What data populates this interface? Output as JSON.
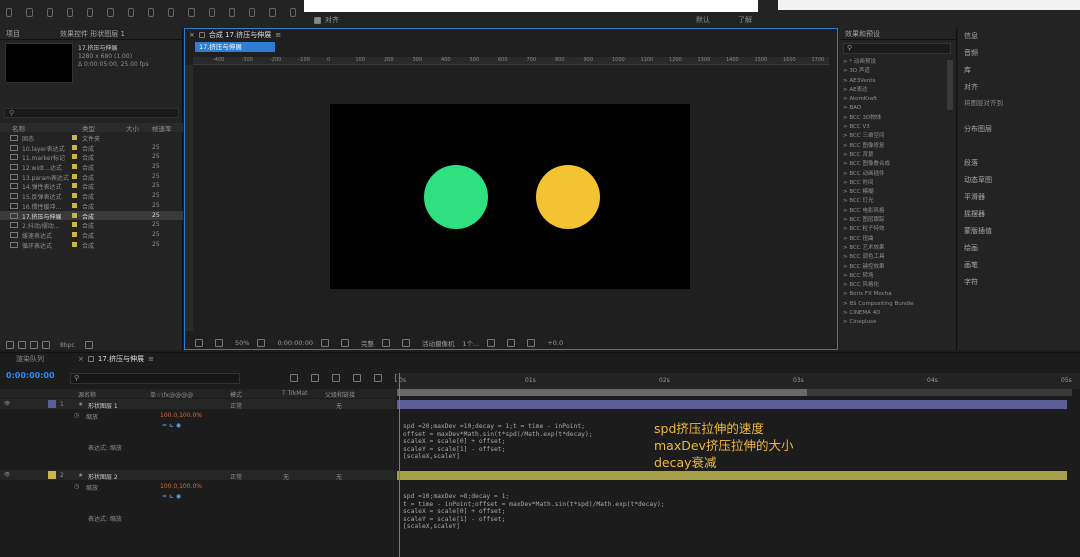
{
  "toolbar": {
    "snap_label": "对齐",
    "workspace_default": "默认",
    "workspace_learn": "了解"
  },
  "project": {
    "tab_label": "项目",
    "effect_controls_label": "效果控件 形状图层 1",
    "comp_name": "17.挤压与伸展",
    "comp_size": "1280 x 680 (1.00)",
    "comp_duration": "Δ 0:00:05:00, 25.00 fps",
    "columns": {
      "name": "名称",
      "type": "类型",
      "size": "大小",
      "rate": "帧速率"
    },
    "items": [
      {
        "name": "固态",
        "type": "文件夹",
        "rate": ""
      },
      {
        "name": "10.layer表达式",
        "type": "合成",
        "rate": "25"
      },
      {
        "name": "11.marker标记",
        "type": "合成",
        "rate": "25"
      },
      {
        "name": "12.widt...达式",
        "type": "合成",
        "rate": "25"
      },
      {
        "name": "13.param表达式",
        "type": "合成",
        "rate": "25"
      },
      {
        "name": "14.弹性表达式",
        "type": "合成",
        "rate": "25"
      },
      {
        "name": "15.反弹表达式",
        "type": "合成",
        "rate": "25"
      },
      {
        "name": "16.惯性缓冲...",
        "type": "合成",
        "rate": "25"
      },
      {
        "name": "17.挤压与伸展",
        "type": "合成",
        "rate": "25"
      },
      {
        "name": "2.抖动/摆动...",
        "type": "合成",
        "rate": "25"
      },
      {
        "name": "缓速表达式",
        "type": "合成",
        "rate": "25"
      },
      {
        "name": "循环表达式",
        "type": "合成",
        "rate": "25"
      }
    ],
    "bpc": "8bpc"
  },
  "comp": {
    "tab_label": "合成 17.挤压与伸展",
    "breadcrumb": "17.挤压与伸展",
    "ruler_ticks": [
      "-400",
      "-300",
      "-200",
      "-100",
      "0",
      "100",
      "200",
      "300",
      "400",
      "500",
      "600",
      "700",
      "800",
      "900",
      "1000",
      "1100",
      "1200",
      "1300",
      "1400",
      "1500",
      "1600",
      "1700"
    ],
    "footer": {
      "zoom": "50%",
      "timecode": "0:00:00:00",
      "quality": "完整",
      "camera": "活动摄像机",
      "views": "1个...",
      "exposure": "+0.0"
    },
    "colors": {
      "green": "#2ee07f",
      "yellow": "#f3c332"
    }
  },
  "effects": {
    "title": "效果和预设",
    "items": [
      "* 动画预设",
      "3D 声道",
      "AE3Vents",
      "AE表达",
      "AtomKraft",
      "BAO",
      "BCC 3D物体",
      "BCC V3",
      "BCC 三维空间",
      "BCC 图像修复",
      "BCC 背景",
      "BCC 图像叠合成",
      "BCC 动画插件",
      "BCC 时间",
      "BCC 模糊",
      "BCC 灯光",
      "BCC 电影风格",
      "BCC 图层跟踪",
      "BCC 粒子特效",
      "BCC 扭曲",
      "BCC 艺术效果",
      "BCC 调色工具",
      "BCC 键控效果",
      "BCC 转场",
      "BCC 风格化",
      "Boris FX Mocha",
      "BS Compositing Bundle",
      "CINEMA 4D",
      "Cinepluse"
    ]
  },
  "right_panel": {
    "items": [
      "信息",
      "音频",
      "库",
      "对齐",
      "将图层对齐到",
      "分布图层",
      "段落",
      "动态草图",
      "平滑器",
      "摇摆器",
      "蒙版插值",
      "绘画",
      "画笔",
      "字符"
    ]
  },
  "timeline": {
    "render_queue_label": "渲染队列",
    "comp_tab_label": "17.挤压与伸展",
    "timecode": "0:00:00:00",
    "columns": {
      "source": "源名称",
      "switches": "单☆\\fx@@@@",
      "mode": "模式",
      "trkmat": "T TrkMat",
      "parent": "父级和链接"
    },
    "layers": [
      {
        "num": "1",
        "name": "形状图层 1",
        "mode": "正常",
        "trkmat": "",
        "parent": "无",
        "prop": "缩放",
        "value": "100.0,100.0%",
        "expr_label": "表达式: 缩放"
      },
      {
        "num": "2",
        "name": "形状图层 2",
        "mode": "正常",
        "trkmat": "无",
        "parent": "无",
        "prop": "缩放",
        "value": "100.0,100.0%",
        "expr_label": "表达式: 缩放"
      }
    ],
    "time_ticks": [
      "0s",
      "01s",
      "02s",
      "03s",
      "04s",
      "05s"
    ],
    "expressions": [
      "spd =20;maxDev =10;decay = 1;t = time - inPoint;\noffset = maxDev*Math.sin(t*spd)/Math.exp(t*decay);\nscaleX = scale[0] + offset;\nscaleY = scale[1] - offset;\n[scaleX,scaleY]",
      "spd =10;maxDev =8;decay = 1;\nt = time - inPoint;offset = maxDev*Math.sin(t*spd)/Math.exp(t*decay);\nscaleX = scale[0] + offset;\nscaleY = scale[1] - offset;\n[scaleX,scaleY]"
    ],
    "annotation": [
      "spd挤压拉伸的速度",
      "maxDev挤压拉伸的大小",
      "decay衰减"
    ]
  }
}
